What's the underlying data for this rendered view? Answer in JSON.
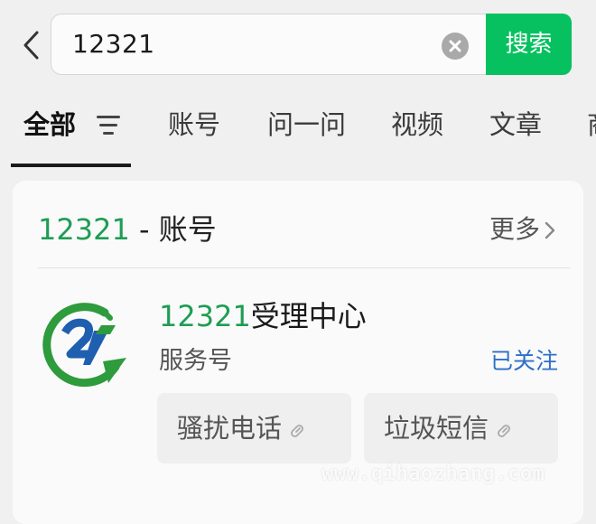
{
  "search": {
    "query": "12321",
    "button_label": "搜索"
  },
  "tabs": [
    {
      "label": "全部",
      "active": true
    },
    {
      "label": "账号"
    },
    {
      "label": "问一问"
    },
    {
      "label": "视频"
    },
    {
      "label": "文章"
    },
    {
      "label": "商"
    }
  ],
  "result_card": {
    "title_keyword": "12321",
    "title_rest": " - 账号",
    "more_label": "更多",
    "account": {
      "name_keyword": "12321",
      "name_rest": "受理中心",
      "type": "服务号",
      "follow_status": "已关注",
      "menu_items": [
        {
          "label": "骚扰电话"
        },
        {
          "label": "垃圾短信"
        }
      ]
    }
  },
  "watermark": "www.qihaozhang.com",
  "colors": {
    "accent_green": "#07c160",
    "keyword_green": "#1e9d54",
    "followed_blue": "#2d6fc8"
  }
}
